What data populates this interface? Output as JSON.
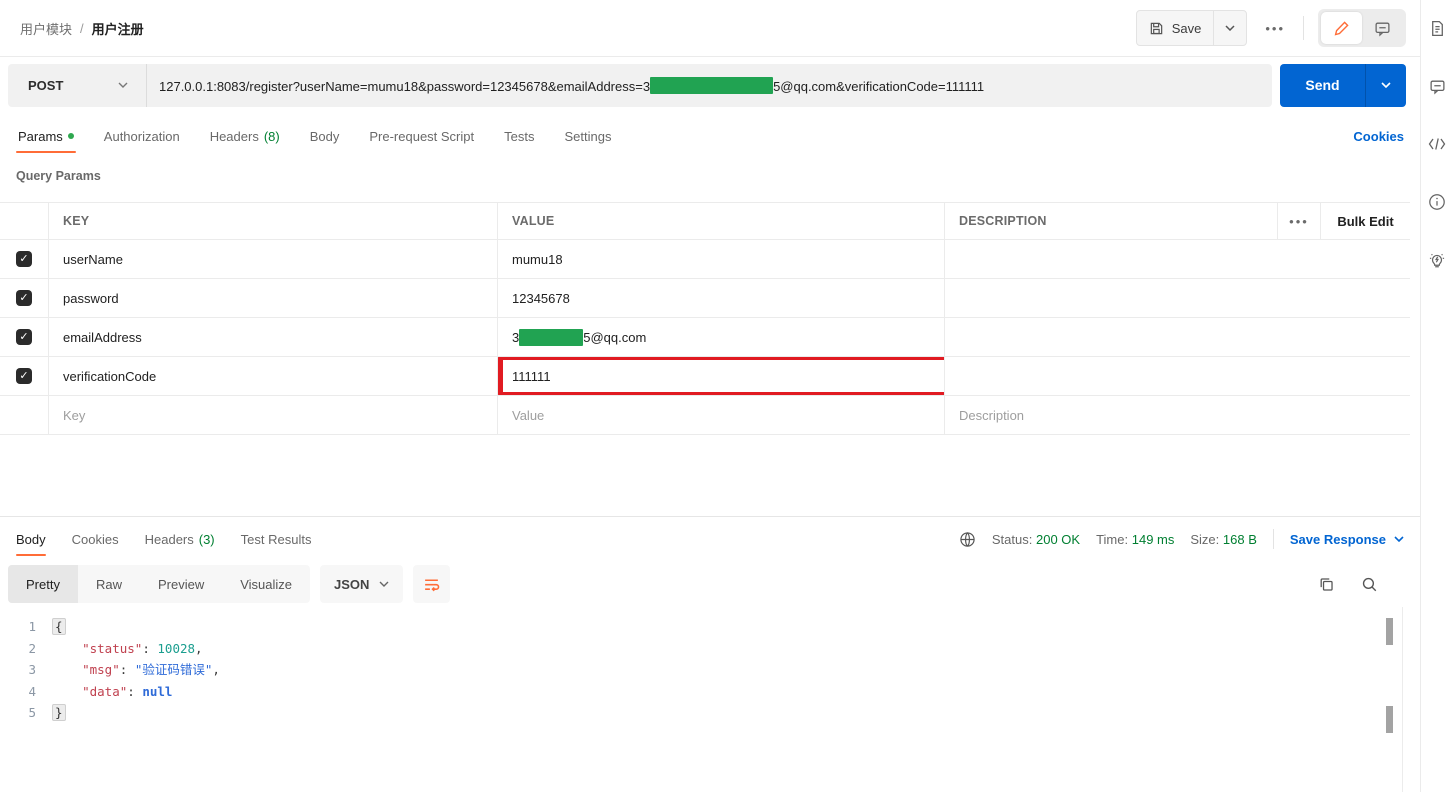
{
  "breadcrumb": {
    "collection": "用户模块",
    "separator": "/",
    "request": "用户注册"
  },
  "header_actions": {
    "save_label": "Save",
    "more_dots": "•••"
  },
  "request_bar": {
    "method": "POST",
    "url_prefix": "127.0.0.1:8083/register?userName=mumu18&password=12345678&emailAddress=3",
    "url_suffix": "5@qq.com&verificationCode=111111",
    "send_label": "Send"
  },
  "request_tabs": {
    "items": [
      {
        "label": "Params"
      },
      {
        "label": "Authorization"
      },
      {
        "label": "Headers",
        "count": "(8)"
      },
      {
        "label": "Body"
      },
      {
        "label": "Pre-request Script"
      },
      {
        "label": "Tests"
      },
      {
        "label": "Settings"
      }
    ],
    "cookies_link": "Cookies"
  },
  "query_params": {
    "section_label": "Query Params",
    "columns": {
      "key": "KEY",
      "value": "VALUE",
      "description": "DESCRIPTION"
    },
    "more_dots": "•••",
    "bulk_edit_label": "Bulk Edit",
    "check_glyph": "✓",
    "rows": [
      {
        "key": "userName",
        "value": "mumu18"
      },
      {
        "key": "password",
        "value": "12345678"
      },
      {
        "key": "emailAddress",
        "value_prefix": "3",
        "value_suffix": "5@qq.com"
      },
      {
        "key": "verificationCode",
        "value": "111111"
      }
    ],
    "placeholder_row": {
      "key": "Key",
      "value": "Value",
      "description": "Description"
    }
  },
  "response": {
    "tabs": [
      {
        "label": "Body"
      },
      {
        "label": "Cookies"
      },
      {
        "label": "Headers",
        "count": "(3)"
      },
      {
        "label": "Test Results"
      }
    ],
    "meta": {
      "status_label": "Status:",
      "status_value": "200 OK",
      "time_label": "Time:",
      "time_value": "149 ms",
      "size_label": "Size:",
      "size_value": "168 B",
      "save_response_label": "Save Response"
    },
    "toolbar": {
      "views": [
        "Pretty",
        "Raw",
        "Preview",
        "Visualize"
      ],
      "format": "JSON"
    },
    "code": {
      "l1": {
        "num": "1",
        "open": "{"
      },
      "l2": {
        "num": "2",
        "indent": "    ",
        "key": "\"status\"",
        "colon": ": ",
        "value": "10028",
        "comma": ","
      },
      "l3": {
        "num": "3",
        "indent": "    ",
        "key": "\"msg\"",
        "colon": ": ",
        "value": "\"验证码错误\"",
        "comma": ","
      },
      "l4": {
        "num": "4",
        "indent": "    ",
        "key": "\"data\"",
        "colon": ": ",
        "value": "null"
      },
      "l5": {
        "num": "5",
        "close": "}"
      }
    }
  },
  "colors": {
    "accent_orange": "#ff6c37",
    "send_blue": "#0265d2",
    "success_green": "#007f31",
    "redaction_green": "#21a352",
    "highlight_red": "#e11b22"
  }
}
